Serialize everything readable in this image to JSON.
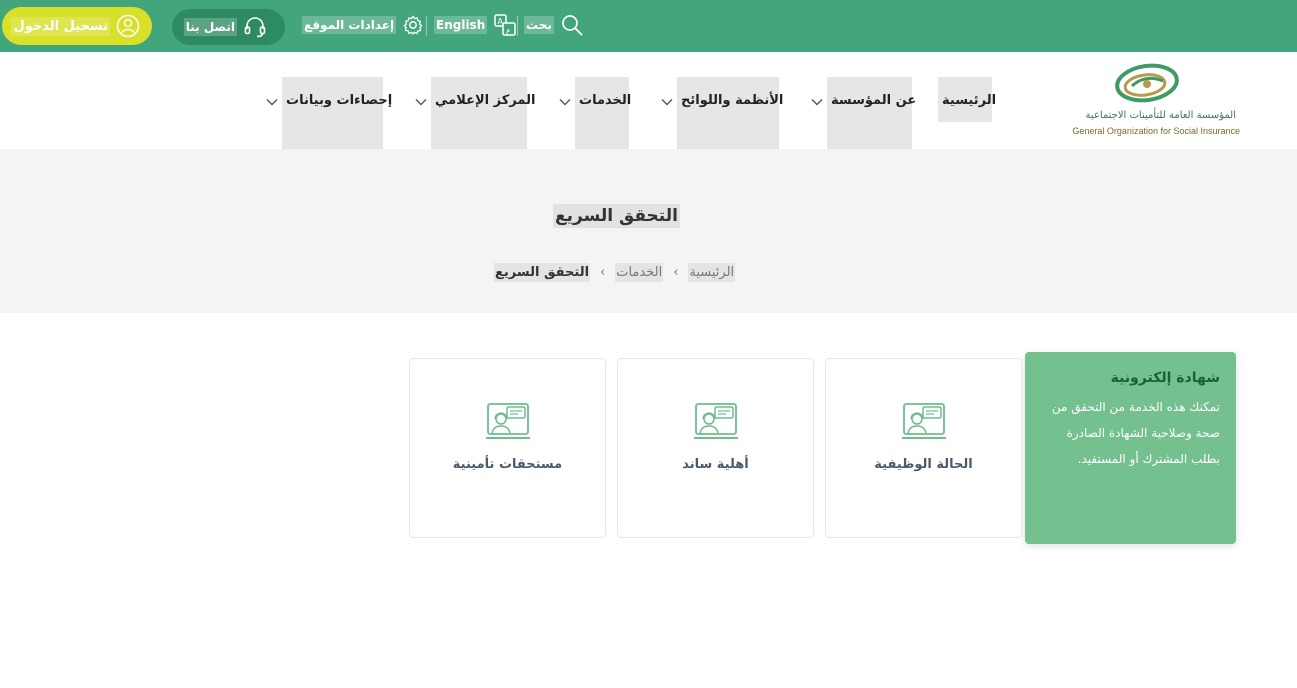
{
  "topbar": {
    "login_label": "تسجيل الدخول",
    "contact_label": "اتصل بنا",
    "settings_label": "إعدادات الموقع",
    "language_label": "English",
    "search_label": "بحث"
  },
  "logo": {
    "arabic_name": "المؤسسة العامة للتأمينات الاجتماعية",
    "english_name": "General Organization for Social Insurance"
  },
  "nav": {
    "items": [
      {
        "label": "الرئيسية"
      },
      {
        "label": "عن المؤسسة"
      },
      {
        "label": "الأنظمة واللوائح"
      },
      {
        "label": "الخدمات"
      },
      {
        "label": "المركز الإعلامي"
      },
      {
        "label": "إحصاءات وبيانات"
      }
    ]
  },
  "page": {
    "title": "التحقق السريع",
    "breadcrumb": [
      "الرئيسية",
      "الخدمات",
      "التحقق السريع"
    ]
  },
  "feature": {
    "title": "شهادة إلكترونية",
    "description": "تمكنك هذه الخدمة من التحقق من صحة وصلاحية الشهادة الصادرة بطلب المشترك أو المستفيد."
  },
  "cards": [
    {
      "title": "الحالة الوظيفية"
    },
    {
      "title": "أهلية ساند"
    },
    {
      "title": "مستحقات تأمينية"
    }
  ],
  "colors": {
    "brand_green": "#43a57b",
    "login_yellow": "#d8e02a",
    "feature_green": "#74c08e"
  }
}
